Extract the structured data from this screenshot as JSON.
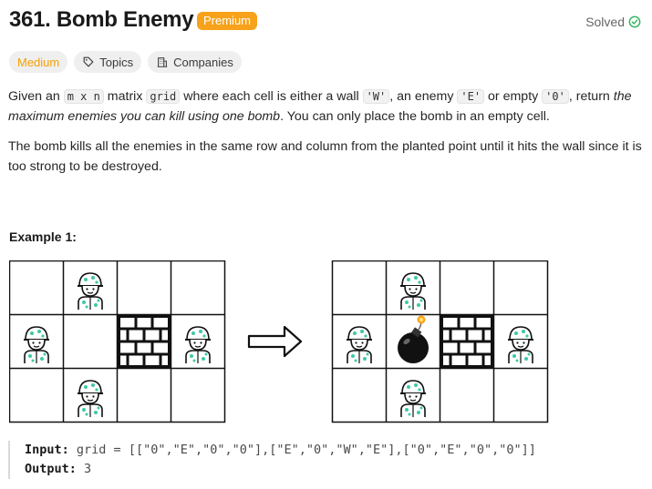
{
  "problem": {
    "title": "361. Bomb Enemy",
    "premium_label": "Premium",
    "status": "Solved"
  },
  "tags": {
    "difficulty": "Medium",
    "topics": "Topics",
    "companies": "Companies"
  },
  "description": {
    "p1_a": "Given an ",
    "p1_code_m": "m x n",
    "p1_b": " matrix ",
    "p1_code_grid": "grid",
    "p1_c": " where each cell is either a wall ",
    "p1_code_w": "'W'",
    "p1_d": ", an enemy ",
    "p1_code_e": "'E'",
    "p1_e": " or empty ",
    "p1_code_0": "'0'",
    "p1_f": ", return ",
    "p1_italic": "the maximum enemies you can kill using one bomb",
    "p1_g": ". You can only place the bomb in an empty cell.",
    "p2": "The bomb kills all the enemies in the same row and column from the planted point until it hits the wall since it is too strong to be destroyed."
  },
  "example": {
    "title": "Example 1:",
    "input_label": "Input:",
    "input_value": "grid = [[\"0\",\"E\",\"0\",\"0\"],[\"E\",\"0\",\"W\",\"E\"],[\"0\",\"E\",\"0\",\"0\"]]",
    "output_label": "Output:",
    "output_value": "3",
    "grid_before": [
      [
        "0",
        "E",
        "0",
        "0"
      ],
      [
        "E",
        "0",
        "W",
        "E"
      ],
      [
        "0",
        "E",
        "0",
        "0"
      ]
    ],
    "grid_after": [
      [
        "0",
        "E",
        "0",
        "0"
      ],
      [
        "E",
        "B",
        "W",
        "E"
      ],
      [
        "0",
        "E",
        "0",
        "0"
      ]
    ]
  },
  "colors": {
    "accent_premium": "#f7a21a",
    "difficulty_medium": "#f2a007",
    "solved_check": "#2db55d",
    "soldier_green": "#3ec9a7"
  }
}
